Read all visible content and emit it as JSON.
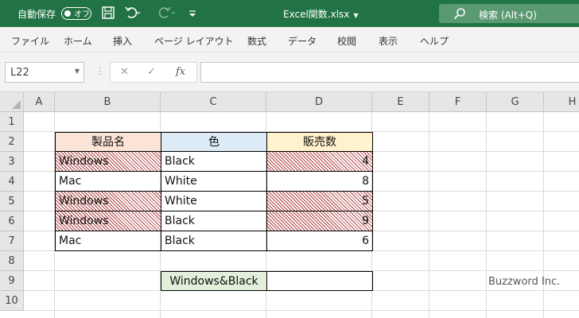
{
  "titlebar": {
    "autosave_label": "自動保存",
    "autosave_state": "オフ",
    "doc_title": "Excel関数.xlsx",
    "search_placeholder": "検索 (Alt+Q)",
    "bg_color": "#217346"
  },
  "ribbon": {
    "tabs": [
      "ファイル",
      "ホーム",
      "挿入",
      "ページ レイアウト",
      "数式",
      "データ",
      "校閲",
      "表示",
      "ヘルプ"
    ]
  },
  "formula_bar": {
    "name_box": "L22",
    "fx_label": "fx",
    "formula": ""
  },
  "sheet": {
    "columns": [
      "A",
      "B",
      "C",
      "D",
      "E",
      "F",
      "G",
      "H"
    ],
    "rows": [
      "1",
      "2",
      "3",
      "4",
      "5",
      "6",
      "7",
      "8",
      "9",
      "10"
    ],
    "table": {
      "headers": [
        "製品名",
        "色",
        "販売数"
      ],
      "rows": [
        {
          "product": "Windows",
          "color": "Black",
          "sales": "4",
          "highlighted": true
        },
        {
          "product": "Mac",
          "color": "White",
          "sales": "8",
          "highlighted": false
        },
        {
          "product": "Windows",
          "color": "White",
          "sales": "5",
          "highlighted": true
        },
        {
          "product": "Windows",
          "color": "Black",
          "sales": "9",
          "highlighted": true
        },
        {
          "product": "Mac",
          "color": "Black",
          "sales": "6",
          "highlighted": false
        }
      ]
    },
    "criteria_label": "Windows&Black",
    "criteria_result": "",
    "watermark": "Buzzword Inc."
  }
}
